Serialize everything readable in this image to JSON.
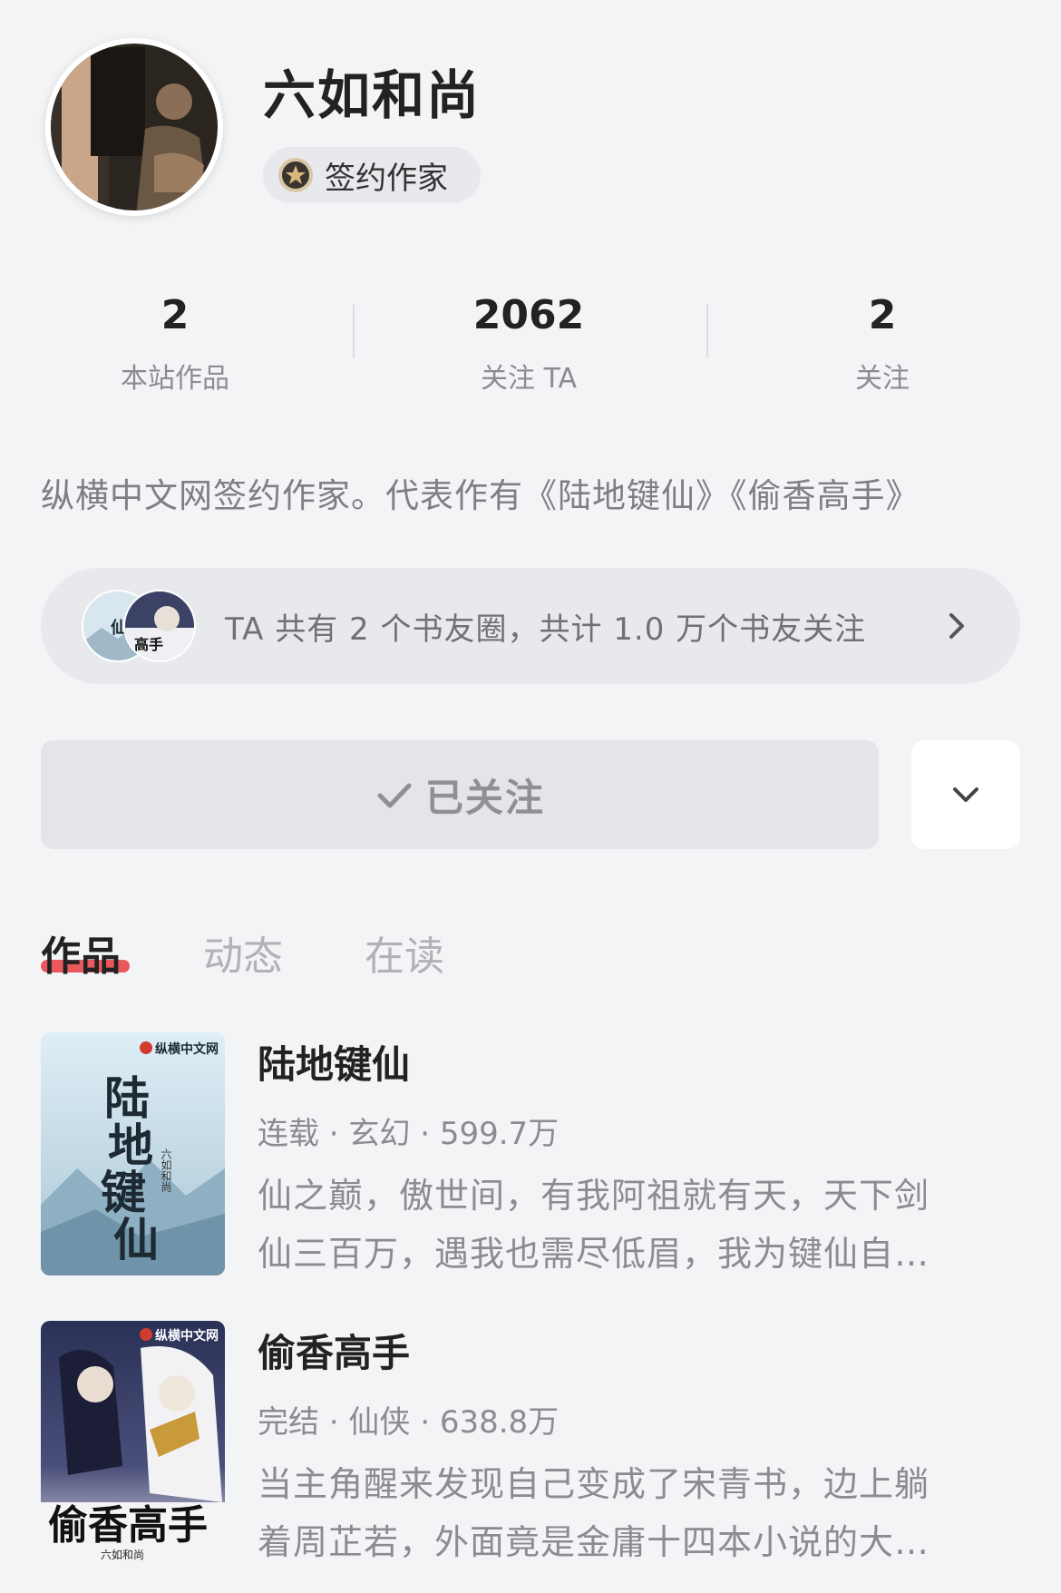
{
  "profile": {
    "name": "六如和尚",
    "badge": "签约作家"
  },
  "stats": [
    {
      "value": "2",
      "label": "本站作品"
    },
    {
      "value": "2062",
      "label": "关注 TA"
    },
    {
      "value": "2",
      "label": "关注"
    }
  ],
  "bio": "纵横中文网签约作家。代表作有《陆地键仙》《偷香高手》",
  "circle": {
    "text": "TA 共有 2 个书友圈，共计 1.0 万个书友关注"
  },
  "follow": {
    "label": "已关注"
  },
  "tabs": [
    "作品",
    "动态",
    "在读"
  ],
  "books": [
    {
      "title": "陆地键仙",
      "meta": "连载 · 玄幻 · 599.7万",
      "desc_line1": "仙之巅，傲世间，有我阿祖就有天，天下剑",
      "desc_line2": "仙三百万，遇我也需尽低眉，我为键仙自…",
      "cover_publisher": "纵横中文网",
      "cover_title": "陆地键仙",
      "cover_author": "六如和尚"
    },
    {
      "title": "偷香高手",
      "meta": "完结 · 仙侠 · 638.8万",
      "desc_line1": "当主角醒来发现自己变成了宋青书，边上躺",
      "desc_line2": "着周芷若，外面竟是金庸十四本小说的大…",
      "cover_publisher": "纵横中文网",
      "cover_title": "偷香高手",
      "cover_author": "六如和尚"
    }
  ],
  "colors": {
    "background": "#f3f4f6",
    "accent": "#e8474a",
    "muted_text": "#8a8c92"
  }
}
